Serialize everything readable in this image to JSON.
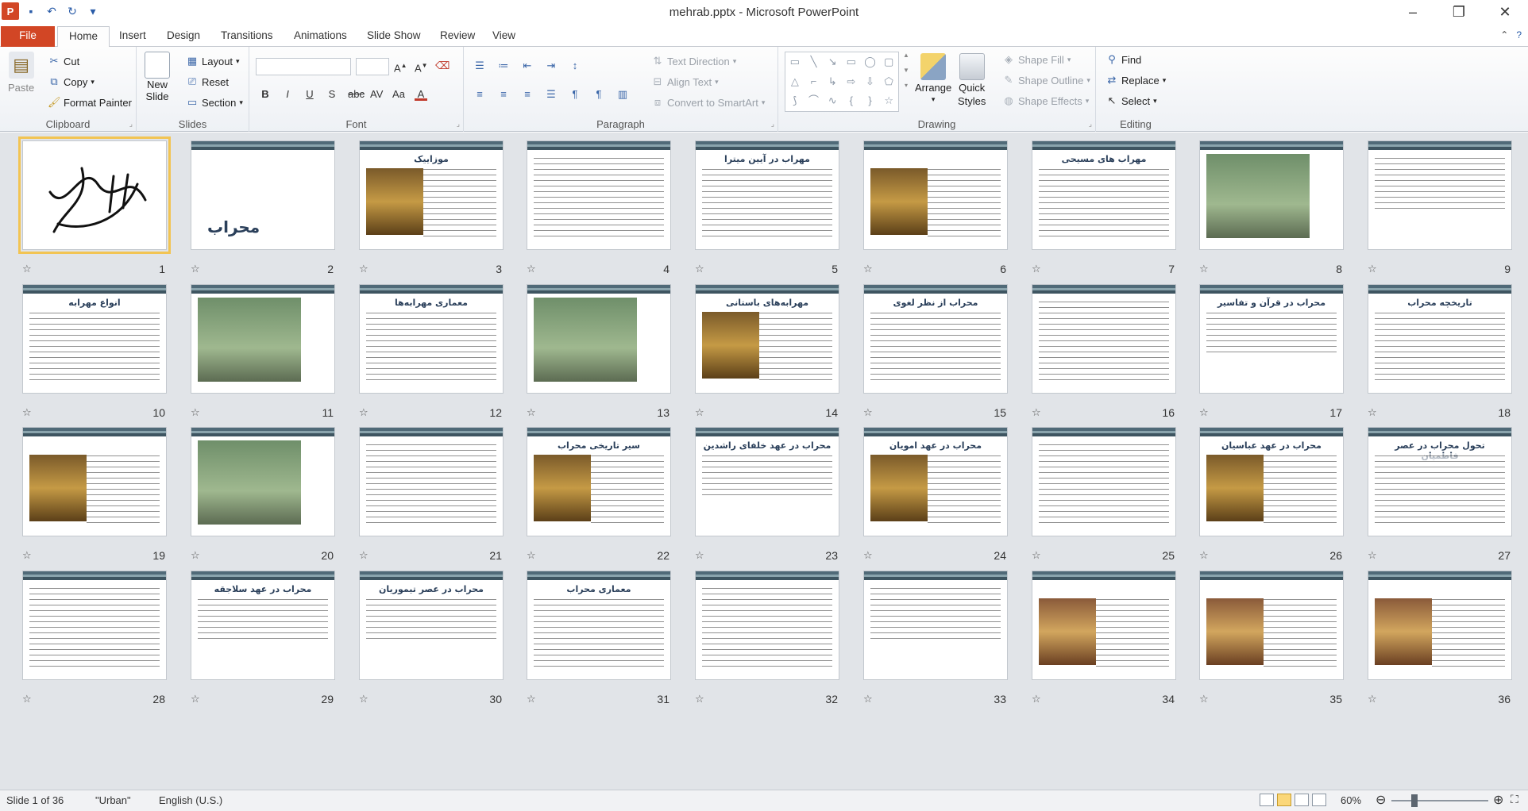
{
  "window": {
    "title": "mehrab.pptx - Microsoft PowerPoint",
    "qat_separator": "▾"
  },
  "tabs": {
    "file": "File",
    "items": [
      "Home",
      "Insert",
      "Design",
      "Transitions",
      "Animations",
      "Slide Show",
      "Review",
      "View"
    ],
    "active": "Home"
  },
  "ribbon": {
    "clipboard": {
      "label": "Clipboard",
      "paste": "Paste",
      "cut": "Cut",
      "copy": "Copy",
      "format_painter": "Format Painter"
    },
    "slides": {
      "label": "Slides",
      "new_slide_1": "New",
      "new_slide_2": "Slide",
      "layout": "Layout",
      "reset": "Reset",
      "section": "Section"
    },
    "font": {
      "label": "Font",
      "font_name": "",
      "font_size": ""
    },
    "paragraph": {
      "label": "Paragraph",
      "text_direction": "Text Direction",
      "align_text": "Align Text",
      "convert_smartart": "Convert to SmartArt"
    },
    "drawing": {
      "label": "Drawing",
      "arrange": "Arrange",
      "quick_styles_1": "Quick",
      "quick_styles_2": "Styles",
      "shape_fill": "Shape Fill",
      "shape_outline": "Shape Outline",
      "shape_effects": "Shape Effects"
    },
    "editing": {
      "label": "Editing",
      "find": "Find",
      "replace": "Replace",
      "select": "Select"
    }
  },
  "slides": [
    {
      "n": "1",
      "kind": "calligraphy",
      "title": ""
    },
    {
      "n": "2",
      "kind": "title",
      "title": "محراب"
    },
    {
      "n": "3",
      "kind": "img-right",
      "title": "موزاییک"
    },
    {
      "n": "4",
      "kind": "text",
      "title": ""
    },
    {
      "n": "5",
      "kind": "text",
      "title": "مهراب در آیین میترا"
    },
    {
      "n": "6",
      "kind": "img-right",
      "title": ""
    },
    {
      "n": "7",
      "kind": "text",
      "title": "مهراب های مسیحی"
    },
    {
      "n": "8",
      "kind": "photo",
      "title": ""
    },
    {
      "n": "9",
      "kind": "short",
      "title": ""
    },
    {
      "n": "10",
      "kind": "text",
      "title": "انواع مهرابه"
    },
    {
      "n": "11",
      "kind": "photo",
      "title": ""
    },
    {
      "n": "12",
      "kind": "text",
      "title": "معماری مهرابه‌ها"
    },
    {
      "n": "13",
      "kind": "photo",
      "title": ""
    },
    {
      "n": "14",
      "kind": "img-right",
      "title": "مهرابه‌های باستانی"
    },
    {
      "n": "15",
      "kind": "text",
      "title": "محراب از نظر لغوی"
    },
    {
      "n": "16",
      "kind": "text",
      "title": ""
    },
    {
      "n": "17",
      "kind": "short",
      "title": "محراب در قرآن و تفاسیر"
    },
    {
      "n": "18",
      "kind": "text",
      "title": "تاریخچه محراب"
    },
    {
      "n": "19",
      "kind": "img-right",
      "title": ""
    },
    {
      "n": "20",
      "kind": "photo",
      "title": ""
    },
    {
      "n": "21",
      "kind": "text",
      "title": ""
    },
    {
      "n": "22",
      "kind": "img-right",
      "title": "سیر تاریخی محراب"
    },
    {
      "n": "23",
      "kind": "short",
      "title": "محراب در عهد خلفای راشدین"
    },
    {
      "n": "24",
      "kind": "img-right",
      "title": "محراب در عهد امویان"
    },
    {
      "n": "25",
      "kind": "text",
      "title": ""
    },
    {
      "n": "26",
      "kind": "img-right",
      "title": "محراب در عهد عباسیان"
    },
    {
      "n": "27",
      "kind": "text",
      "title": "تحول محراب در عصر فاطمیان"
    },
    {
      "n": "28",
      "kind": "text",
      "title": ""
    },
    {
      "n": "29",
      "kind": "short",
      "title": "محراب در عهد سلاجقه"
    },
    {
      "n": "30",
      "kind": "short",
      "title": "محراب در عصر تیموریان"
    },
    {
      "n": "31",
      "kind": "text",
      "title": "معماری محراب"
    },
    {
      "n": "32",
      "kind": "text",
      "title": ""
    },
    {
      "n": "33",
      "kind": "short",
      "title": ""
    },
    {
      "n": "34",
      "kind": "img-left",
      "title": ""
    },
    {
      "n": "35",
      "kind": "img-left",
      "title": ""
    },
    {
      "n": "36",
      "kind": "img-left",
      "title": ""
    }
  ],
  "status": {
    "slide_info": "Slide 1 of 36",
    "theme": "\"Urban\"",
    "language": "English (U.S.)",
    "zoom": "60%"
  }
}
